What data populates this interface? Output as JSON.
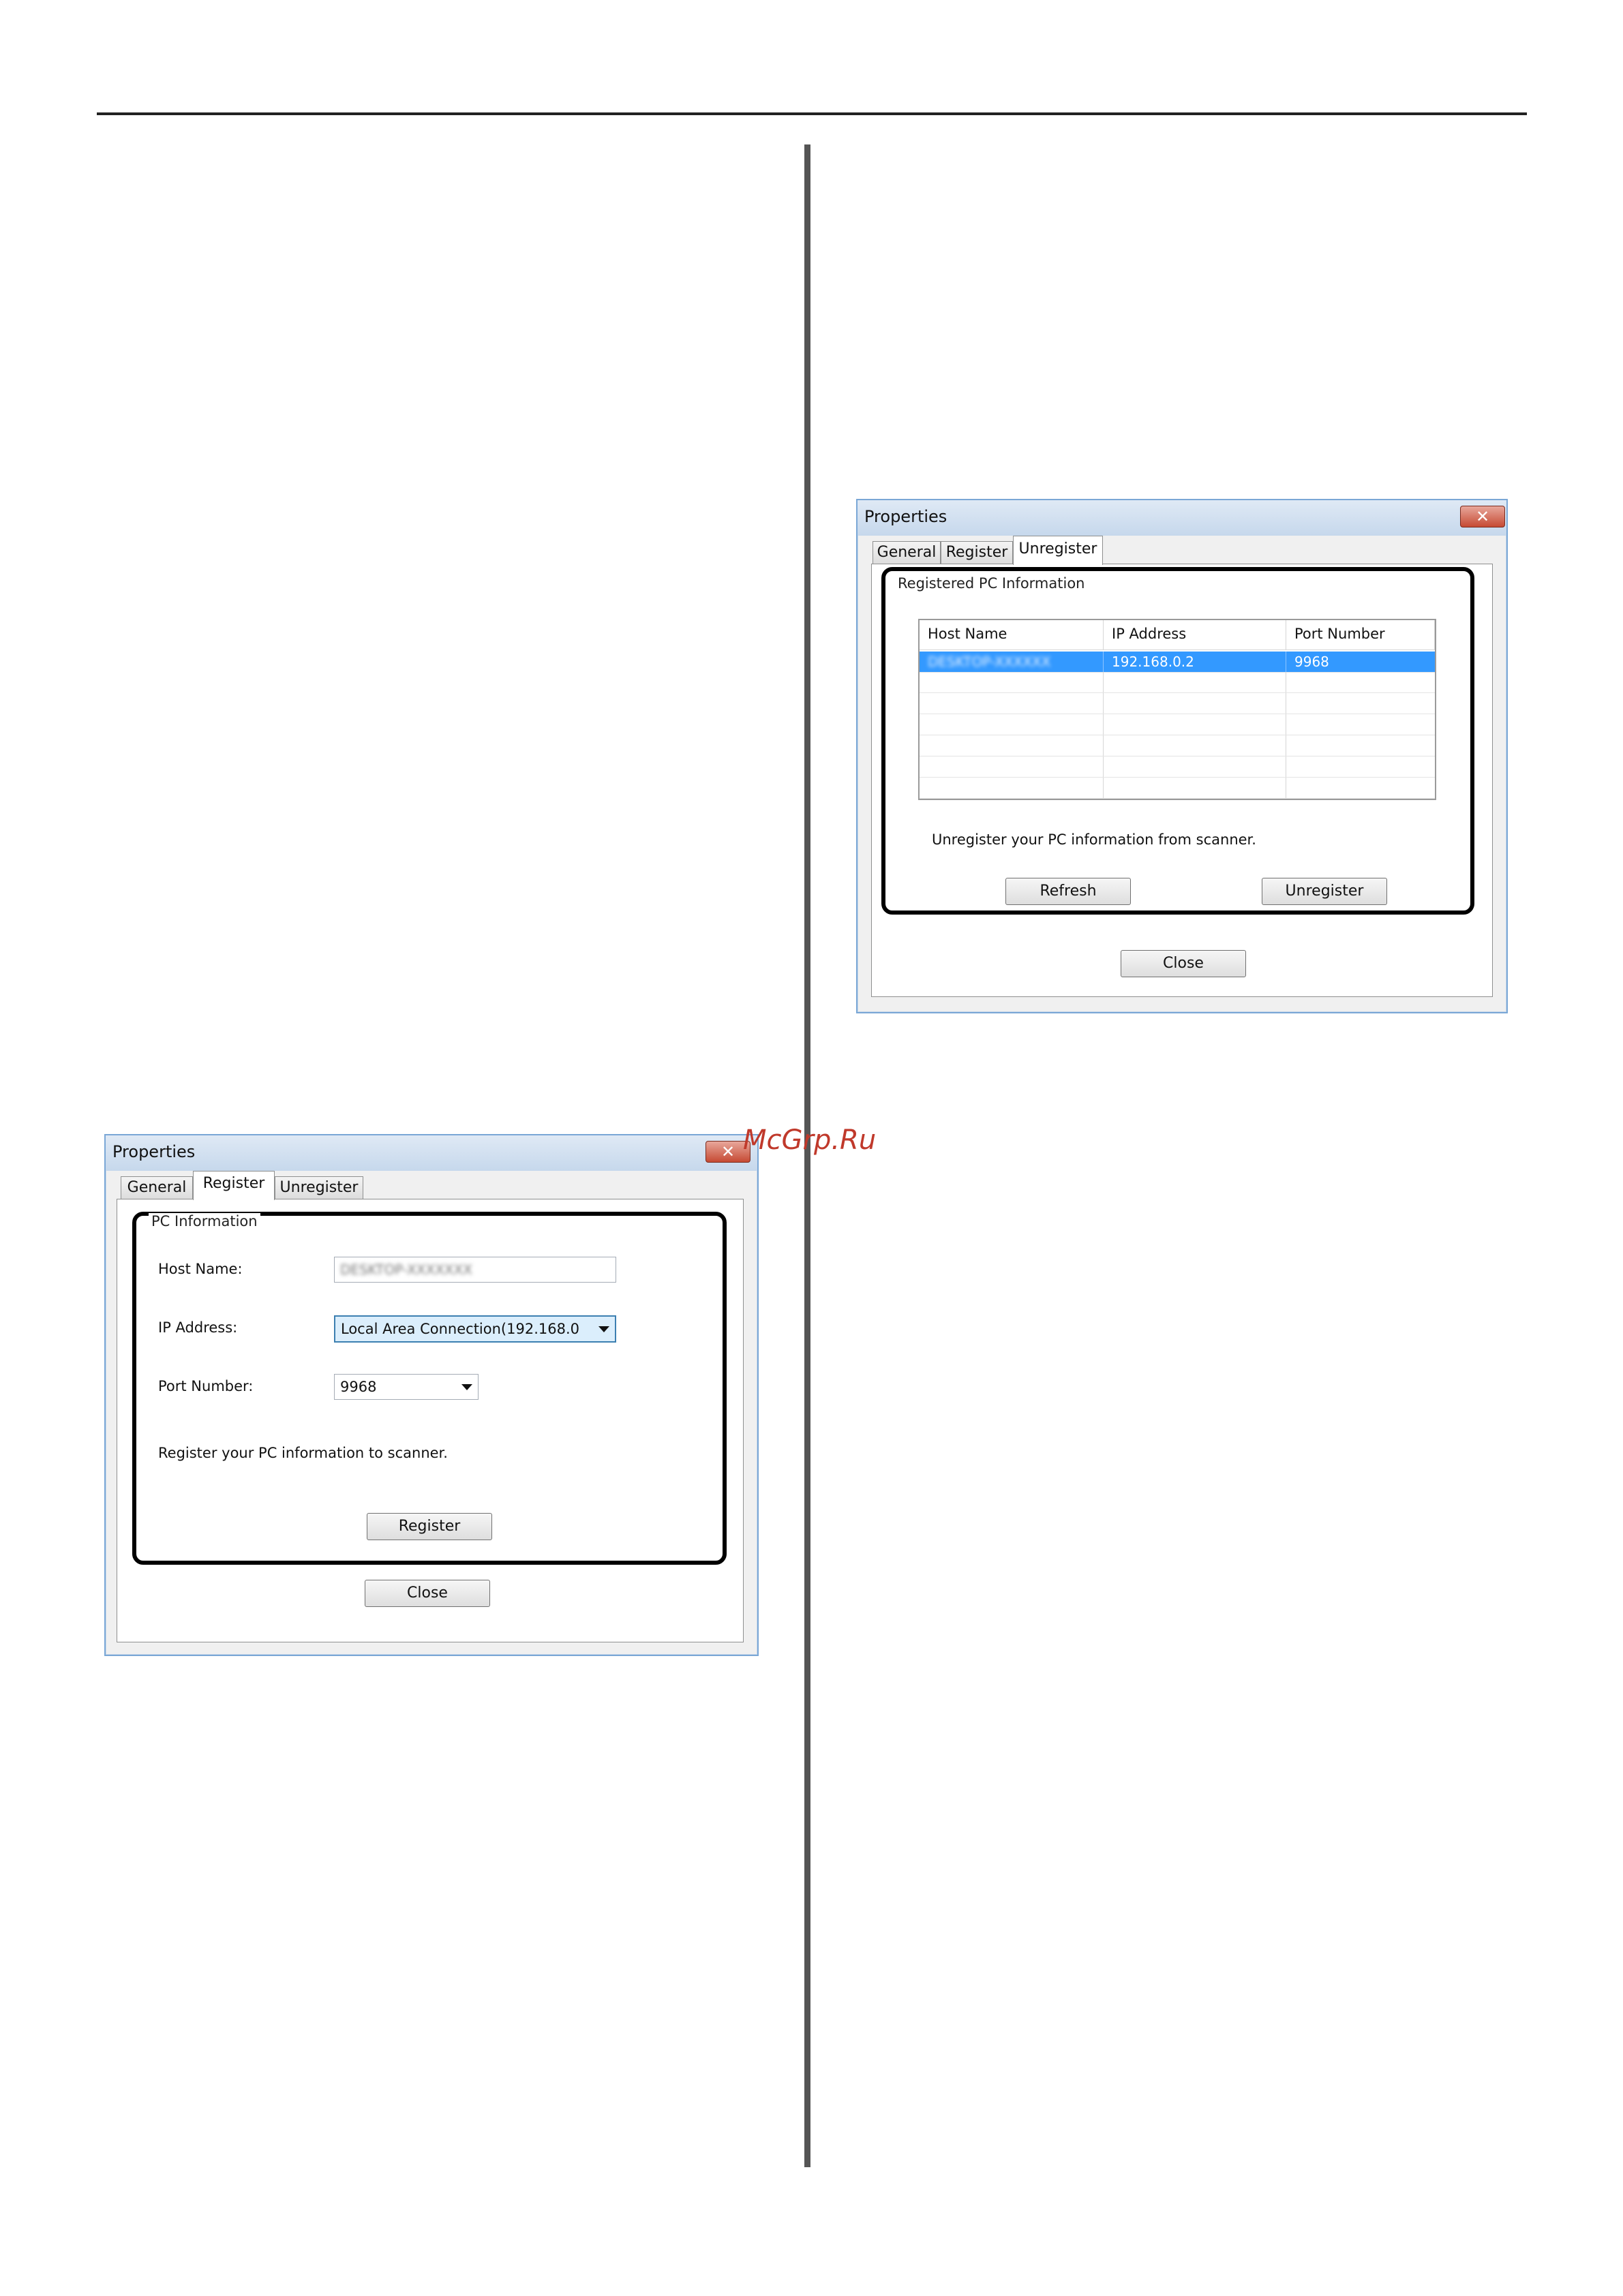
{
  "watermark": "McGrp.Ru",
  "register_dialog": {
    "title": "Properties",
    "close_glyph": "✕",
    "tabs": [
      {
        "label": "General"
      },
      {
        "label": "Register"
      },
      {
        "label": "Unregister"
      }
    ],
    "active_tab": "Register",
    "group_label": "PC Information",
    "host_name_label": "Host Name:",
    "host_name_value": "DESKTOP-XXXXXXX",
    "ip_address_label": "IP Address:",
    "ip_address_value": "Local Area Connection(192.168.0",
    "port_number_label": "Port Number:",
    "port_number_value": "9968",
    "instruction": "Register your PC information to scanner.",
    "register_button": "Register",
    "close_button": "Close"
  },
  "unregister_dialog": {
    "title": "Properties",
    "close_glyph": "✕",
    "tabs": [
      {
        "label": "General"
      },
      {
        "label": "Register"
      },
      {
        "label": "Unregister"
      }
    ],
    "active_tab": "Unregister",
    "group_label": "Registered PC Information",
    "table": {
      "columns": [
        "Host Name",
        "IP Address",
        "Port Number"
      ],
      "rows": [
        {
          "host": "DESKTOP-XXXXXX",
          "ip": "192.168.0.2",
          "port": "9968",
          "selected": true
        }
      ]
    },
    "instruction": "Unregister your PC information from scanner.",
    "refresh_button": "Refresh",
    "unregister_button": "Unregister",
    "close_button": "Close"
  },
  "colors": {
    "selection": "#3399ff",
    "highlight_frame": "#000000",
    "close_button": "#c64a33",
    "watermark": "#c0392b"
  }
}
